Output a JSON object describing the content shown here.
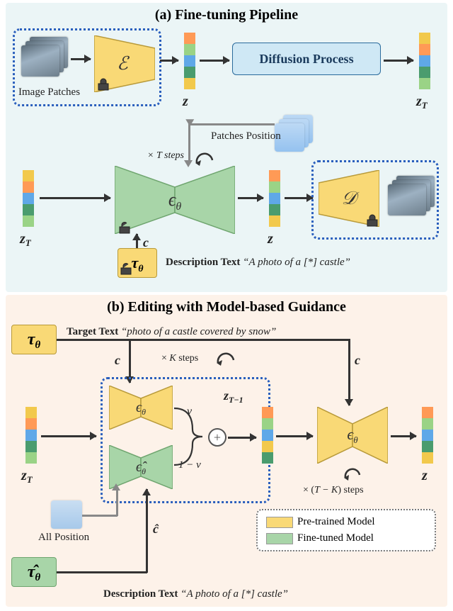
{
  "titles": {
    "a": "(a) Fine-tuning Pipeline",
    "b": "(b) Editing with Model-based Guidance"
  },
  "panel_a": {
    "image_patches_label": "Image Patches",
    "encoder_symbol": "ℰ",
    "decoder_symbol": "𝒟",
    "diffusion_box": "Diffusion Process",
    "z_label_before": "z",
    "z_label_after": "z",
    "zT_label_top": "z_T",
    "zT_label_bottom": "z_T",
    "epsilon_symbol": "ϵ_θ",
    "tau_symbol": "τ_θ",
    "c_label": "c",
    "patches_position": "Patches Position",
    "t_steps": "× T steps",
    "description_label": "Description Text",
    "description_value": "“A photo of a [*] castle”"
  },
  "panel_b": {
    "tau_symbol": "τ_θ",
    "tau_hat_symbol": "τ̂_θ",
    "target_label": "Target Text",
    "target_value": "“photo of a castle covered by snow”",
    "description_label": "Description Text",
    "description_value": "“A photo of a [*] castle”",
    "c_label": "c",
    "c_hat_label": "ĉ",
    "c_label_right": "c",
    "epsilon_yellow": "ϵ_θ",
    "epsilon_green": "ϵ̂_θ",
    "epsilon_right": "ϵ_θ",
    "v_label": "v",
    "one_minus_v": "1 − v",
    "zT_label": "z_T",
    "zTm1_label": "z_{T−1}",
    "z_label": "z",
    "k_steps": "× K steps",
    "tk_steps": "× (T − K) steps",
    "all_position": "All Position"
  },
  "legend": {
    "pretrained": "Pre-trained Model",
    "finetuned": "Fine-tuned Model"
  },
  "icons": {
    "lock_locked": "locked",
    "lock_unlocked": "unlocked"
  }
}
